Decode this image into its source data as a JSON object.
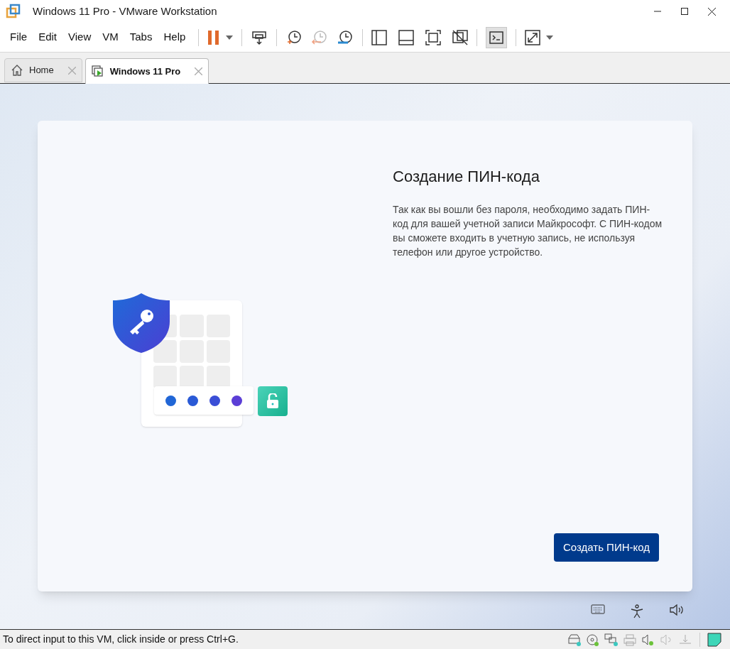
{
  "window": {
    "title": "Windows 11 Pro - VMware Workstation"
  },
  "menu": [
    "File",
    "Edit",
    "View",
    "VM",
    "Tabs",
    "Help"
  ],
  "tabs": [
    {
      "label": "Home",
      "kind": "home",
      "selected": false
    },
    {
      "label": "Windows 11 Pro",
      "kind": "vm",
      "selected": true
    }
  ],
  "setup": {
    "heading": "Создание ПИН-кода",
    "body": "Так как вы вошли без пароля, необходимо задать ПИН-код для вашей учетной записи Майкрософт. С ПИН-кодом вы сможете входить в учетную запись, не используя телефон или другое устройство.",
    "button": "Создать ПИН-код"
  },
  "status_bar": {
    "text": "To direct input to this VM, click inside or press Ctrl+G."
  }
}
